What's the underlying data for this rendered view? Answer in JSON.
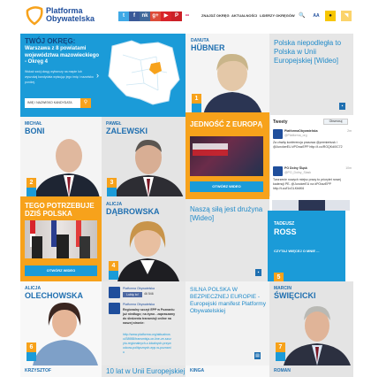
{
  "header": {
    "logo_line1": "Platforma",
    "logo_line2": "Obywatelska",
    "social": [
      {
        "name": "twitter",
        "label": "t",
        "color": "#3fa9e6"
      },
      {
        "name": "facebook",
        "label": "f",
        "color": "#3b5998"
      },
      {
        "name": "nk",
        "label": "nk",
        "color": "#41699a"
      },
      {
        "name": "google-plus",
        "label": "g+",
        "color": "#dd4b39"
      },
      {
        "name": "youtube",
        "label": "▶",
        "color": "#d8232a"
      },
      {
        "name": "pinterest",
        "label": "P",
        "color": "#cb2027"
      },
      {
        "name": "flickr",
        "label": "••",
        "color": "#ffffff"
      }
    ],
    "nav": [
      "ZNAJDŹ OKRĘG",
      "AKTUALNOŚCI",
      "LIDERZY OKRĘGÓW"
    ],
    "search_icon": "🔍",
    "font_size_label": "AA",
    "contrast_icon": "●",
    "rss_icon": "◥"
  },
  "district": {
    "heading": "TWÓJ OKRĘG:",
    "name": "Warszawa z 8 powiatami województwa mazowieckiego - Okręg 4",
    "description": "Wskaż swój okręg wyborczy na mapie lub wyszukaj kandydata wpisując jego imię i nazwisko poniżej.",
    "search_placeholder": "IMIĘ I NAZWISKO KANDYDATA",
    "highlight_color": "#f7a21b"
  },
  "candidates": [
    {
      "first": "DANUTA",
      "last": "HÜBNER",
      "number": "1"
    },
    {
      "first": "MICHAŁ",
      "last": "BONI",
      "number": "2"
    },
    {
      "first": "PAWEŁ",
      "last": "ZALEWSKI",
      "number": "3"
    },
    {
      "first": "ALICJA",
      "last": "DĄBROWSKA",
      "number": "4"
    },
    {
      "first": "TADEUSZ",
      "last": "ROSS",
      "number": "5",
      "more": "CZYTAJ WIĘCEJ O MNIE ..."
    },
    {
      "first": "ALICJA",
      "last": "OLECHOWSKA",
      "number": "6"
    },
    {
      "first": "MARCIN",
      "last": "ŚWIĘCICKI",
      "number": "7"
    },
    {
      "first": "KRZYSZTOF",
      "last": ""
    },
    {
      "first": "KINGA",
      "last": ""
    },
    {
      "first": "ROMAN",
      "last": ""
    }
  ],
  "news": [
    {
      "title": "Polska niepodległa to Polska w Unii Europejskiej [Wideo]"
    },
    {
      "title": "Naszą siłą jest drużyna [Wideo]"
    },
    {
      "title": "SILNA POLSKA W BEZPIECZNEJ EUROPIE - Europejski manifest Platformy Obywatelskiej"
    },
    {
      "title": "10 lat w Unii Europejskiej"
    }
  ],
  "videos": [
    {
      "title": "JEDNOŚĆ Z EUROPĄ",
      "button": "OTWÓRZ WIDEO"
    },
    {
      "title": "TEGO POTRZEBUJE DZIŚ POLSKA",
      "button": "OTWÓRZ WIDEO"
    }
  ],
  "tweets": {
    "heading": "Tweety",
    "follow": "Obserwuj",
    "items": [
      {
        "author": "PlatformaObywatelska",
        "handle": "@Platforma_org",
        "time": "2m",
        "text": "Za chwilę konferencja prasowa @premiertusk i @JunckerEU #POrazEPP http://t.co/ROQKdiXC72"
      },
      {
        "author": "PO Dolny Śląsk",
        "handle": "@PO_Dolny_Slask",
        "time": "10m",
        "text": "Tworzenie nowych miejsc pracy to priorytet nowej kadencji PE- @JunckerEU na #POrazEPP http://t.co/f1vGLKb6K6"
      }
    ]
  },
  "facebook": {
    "page": "Platforma Obywatelska",
    "like": "Lubię to!",
    "likes": "46 546",
    "post_author": "Platforma Obywatelska",
    "post_text": "Regionalny szczyt EPP w Poznaniu już niedługo; na żywo - zapraszamy do śledzenia transmisji online na naszej stronie:",
    "post_link": "http://www.platforma.org/aktualnosci/38988/transmisja-on-line-ze-szczytu-regionalnych-z-lokalnych-przywodcow-politycznych-epp-w-poznaniu"
  },
  "colors": {
    "blue": "#1b9bd8",
    "orange": "#f7a21b",
    "navy": "#1f4e9c"
  }
}
